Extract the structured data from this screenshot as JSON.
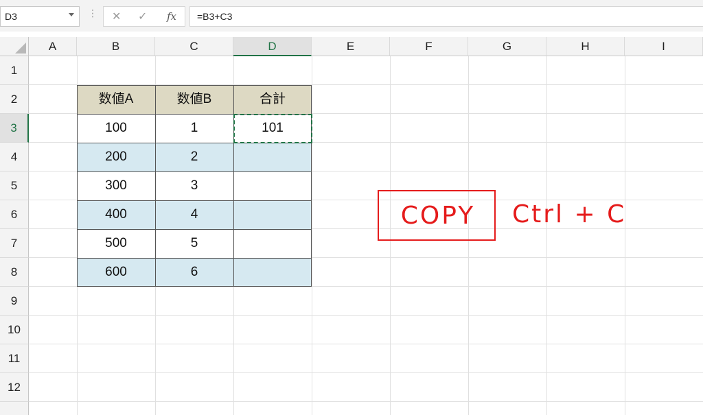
{
  "formula_bar": {
    "name_box": "D3",
    "grip": "⋮",
    "cancel_icon": "✕",
    "enter_icon": "✓",
    "fx_label": "fx",
    "formula": "=B3+C3"
  },
  "columns": [
    "A",
    "B",
    "C",
    "D",
    "E",
    "F",
    "G",
    "H",
    "I"
  ],
  "active_column": "D",
  "rows": [
    "1",
    "2",
    "3",
    "4",
    "5",
    "6",
    "7",
    "8",
    "9",
    "10",
    "11",
    "12"
  ],
  "active_row": "3",
  "table": {
    "headers": [
      "数値A",
      "数値B",
      "合計"
    ],
    "rows": [
      [
        "100",
        "1",
        "101"
      ],
      [
        "200",
        "2",
        ""
      ],
      [
        "300",
        "3",
        ""
      ],
      [
        "400",
        "4",
        ""
      ],
      [
        "500",
        "5",
        ""
      ],
      [
        "600",
        "6",
        ""
      ]
    ]
  },
  "annotation": {
    "copy_label": "COPY",
    "shortcut": "Ctrl + C",
    "color": "#e51b1b"
  },
  "colors": {
    "header_fill": "#ddd9c3",
    "band_fill": "#d6e9f1",
    "accent": "#217346"
  }
}
